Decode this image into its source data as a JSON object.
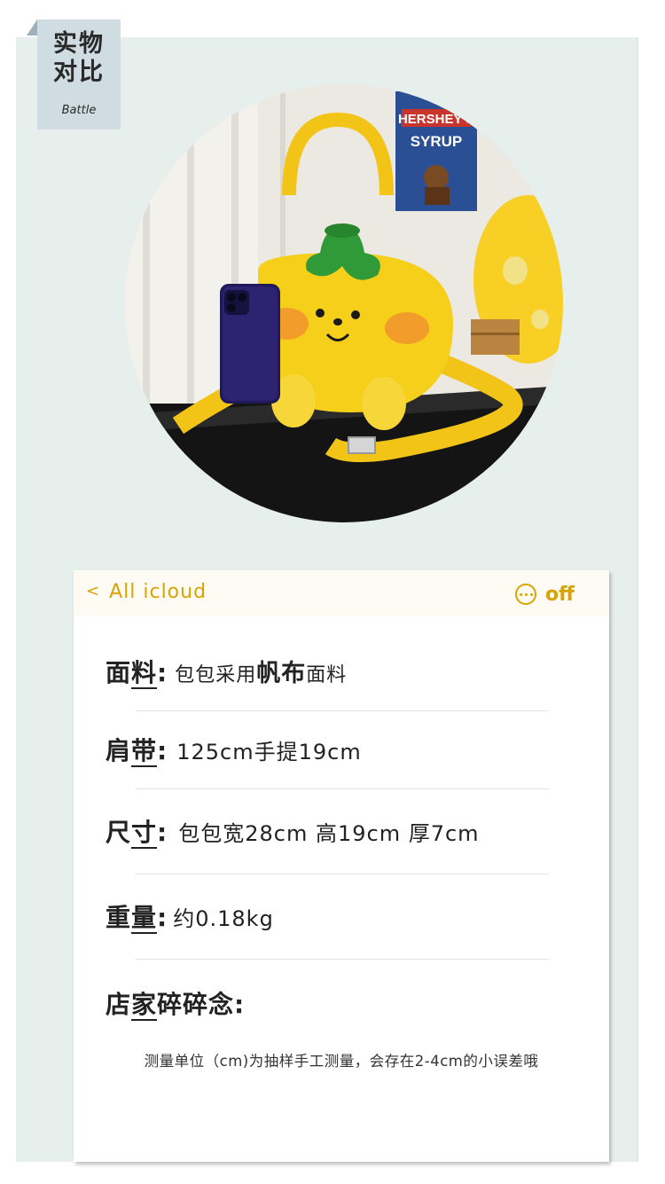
{
  "badge": {
    "title_line1": "实物",
    "title_line2": "对比",
    "subtitle": "Battle"
  },
  "photo": {
    "poster_line1": "HERSHEY'S",
    "poster_line2": "SYRUP"
  },
  "card": {
    "nav_back_label": "All icloud",
    "more_label": "off",
    "specs": [
      {
        "label_a": "面",
        "label_b": "料",
        "value": "包包采用",
        "value_em": "帆布",
        "value_tail": "面料"
      },
      {
        "label_a": "肩",
        "label_b": "带",
        "value": "125cm手提19cm"
      },
      {
        "label_a": "尺",
        "label_b": "寸",
        "value": "包包宽28cm 高19cm 厚7cm"
      },
      {
        "label_a": "重",
        "label_b": "量",
        "value": "约0.18kg"
      }
    ],
    "notes_label_a": "店",
    "notes_label_b": "家",
    "notes_label_c": "碎碎念",
    "note_text": "测量单位（cm)为抽样手工测量，会存在2-4cm的小误差哦"
  },
  "colors": {
    "accent": "#d9a300",
    "panel_bg": "#e7efec",
    "badge_bg": "#cfdce2",
    "bag_yellow": "#f6cf1a",
    "leaf_green": "#2f9a37"
  }
}
